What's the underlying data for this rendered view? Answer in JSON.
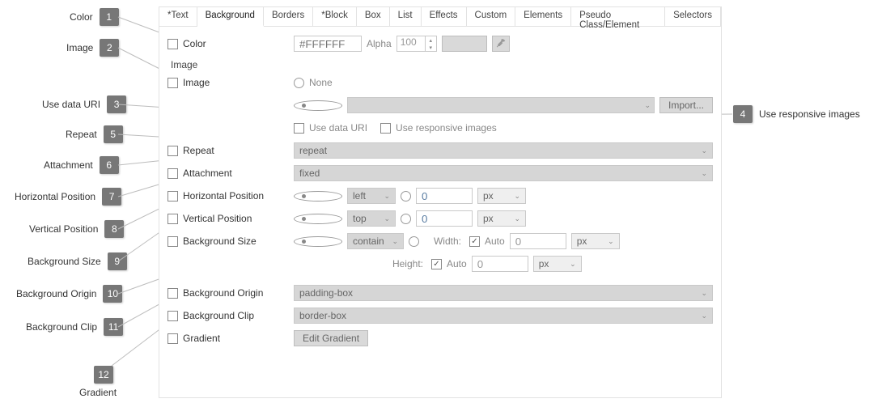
{
  "callouts": {
    "c1": {
      "n": "1",
      "label": "Color"
    },
    "c2": {
      "n": "2",
      "label": "Image"
    },
    "c3": {
      "n": "3",
      "label": "Use data URI"
    },
    "c4": {
      "n": "4",
      "label": "Use responsive images"
    },
    "c5": {
      "n": "5",
      "label": "Repeat"
    },
    "c6": {
      "n": "6",
      "label": "Attachment"
    },
    "c7": {
      "n": "7",
      "label": "Horizontal Position"
    },
    "c8": {
      "n": "8",
      "label": "Vertical Position"
    },
    "c9": {
      "n": "9",
      "label": "Background Size"
    },
    "c10": {
      "n": "10",
      "label": "Background Origin"
    },
    "c11": {
      "n": "11",
      "label": "Background Clip"
    },
    "c12": {
      "n": "12",
      "label": "Gradient"
    }
  },
  "tabs": {
    "t0": "*Text",
    "t1": "Background",
    "t2": "Borders",
    "t3": "*Block",
    "t4": "Box",
    "t5": "List",
    "t6": "Effects",
    "t7": "Custom",
    "t8": "Elements",
    "t9": "Pseudo Class/Element",
    "t10": "Selectors"
  },
  "color": {
    "label": "Color",
    "value_ph": "#FFFFFF",
    "alpha_label": "Alpha",
    "alpha_value": "100"
  },
  "image": {
    "section": "Image",
    "label": "Image",
    "none": "None",
    "use_data_uri": "Use data URI",
    "use_responsive": "Use responsive images",
    "import": "Import..."
  },
  "repeat": {
    "label": "Repeat",
    "value": "repeat"
  },
  "attachment": {
    "label": "Attachment",
    "value": "fixed"
  },
  "hpos": {
    "label": "Horizontal Position",
    "value": "left",
    "num": "0",
    "unit": "px"
  },
  "vpos": {
    "label": "Vertical Position",
    "value": "top",
    "num": "0",
    "unit": "px"
  },
  "bgsize": {
    "label": "Background Size",
    "value": "contain",
    "width": "Width:",
    "height": "Height:",
    "auto": "Auto",
    "zero": "0",
    "unit": "px"
  },
  "origin": {
    "label": "Background Origin",
    "value": "padding-box"
  },
  "clip": {
    "label": "Background Clip",
    "value": "border-box"
  },
  "gradient": {
    "label": "Gradient",
    "button": "Edit Gradient"
  }
}
